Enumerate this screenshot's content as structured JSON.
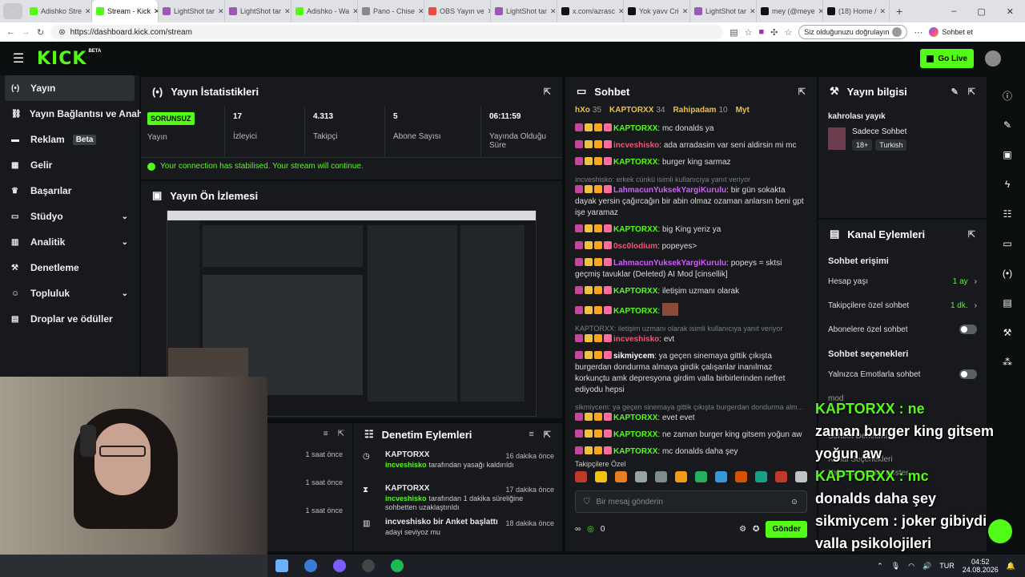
{
  "browser": {
    "tabs": [
      {
        "label": "Adishko Stre",
        "color": "#53fc18",
        "active": false
      },
      {
        "label": "Stream - Kick",
        "color": "#53fc18",
        "active": true
      },
      {
        "label": "LightShot tar",
        "color": "#9b59b6",
        "active": false
      },
      {
        "label": "LightShot tar",
        "color": "#9b59b6",
        "active": false
      },
      {
        "label": "Adishko - Wa",
        "color": "#53fc18",
        "active": false
      },
      {
        "label": "Pano - Chise",
        "color": "#888888",
        "active": false
      },
      {
        "label": "OBS Yayın ve",
        "color": "#e74c3c",
        "active": false
      },
      {
        "label": "LightShot tar",
        "color": "#9b59b6",
        "active": false
      },
      {
        "label": "x.com/azrasc",
        "color": "#111111",
        "active": false
      },
      {
        "label": "Yok yavv Cri",
        "color": "#111111",
        "active": false
      },
      {
        "label": "LightShot tar",
        "color": "#9b59b6",
        "active": false
      },
      {
        "label": "mey (@meye",
        "color": "#111111",
        "active": false
      },
      {
        "label": "(18) Home /",
        "color": "#111111",
        "active": false
      }
    ],
    "url": "https://dashboard.kick.com/stream",
    "verify_label": "Siz olduğunuzu doğrulayın",
    "profile_label": "Sohbet et"
  },
  "header": {
    "logo": "KICK",
    "beta": "BETA",
    "go_live": "Go Live"
  },
  "sidebar": {
    "items": [
      {
        "label": "Yayın",
        "icon": "broadcast-icon",
        "chev": false
      },
      {
        "label": "Yayın Bağlantısı ve Anahtarı",
        "icon": "link-icon",
        "chev": false
      },
      {
        "label": "Reklam",
        "icon": "ad-icon",
        "chev": false,
        "badge": "Beta"
      },
      {
        "label": "Gelir",
        "icon": "money-icon",
        "chev": false
      },
      {
        "label": "Başarılar",
        "icon": "trophy-icon",
        "chev": false
      },
      {
        "label": "Stüdyo",
        "icon": "studio-icon",
        "chev": true
      },
      {
        "label": "Analitik",
        "icon": "chart-icon",
        "chev": true
      },
      {
        "label": "Denetleme",
        "icon": "hammer-icon",
        "chev": false
      },
      {
        "label": "Topluluk",
        "icon": "people-icon",
        "chev": true
      },
      {
        "label": "Droplar ve ödüller",
        "icon": "gift-icon",
        "chev": false
      }
    ]
  },
  "stats": {
    "title": "Yayın İstatistikleri",
    "status": "SORUNSUZ",
    "status_label": "Yayın",
    "items": [
      {
        "value": "17",
        "label": "İzleyici"
      },
      {
        "value": "4.313",
        "label": "Takipçi"
      },
      {
        "value": "5",
        "label": "Abone Sayısı"
      },
      {
        "value": "06:11:59",
        "label": "Yayında Olduğu Süre"
      }
    ],
    "notice": "Your connection has stabilised. Your stream will continue."
  },
  "preview": {
    "title": "Yayın Ön İzlemesi"
  },
  "moderation": {
    "title": "Denetim Eylemleri",
    "left_times": [
      "1 saat önce",
      "1 saat önce",
      "1 saat önce"
    ],
    "items": [
      {
        "user": "KAPTORXX",
        "actor": "incveshisko",
        "text": "tarafından yasağı kaldırıldı",
        "time": "16 dakika önce"
      },
      {
        "user": "KAPTORXX",
        "actor": "incveshisko",
        "text": "tarafından 1 dakika süreliğine sohbetten uzaklaştırıldı",
        "time": "17 dakika önce"
      },
      {
        "user": "incveshisko bir Anket başlattı",
        "actor": "",
        "text": "adayi seviyoz mu",
        "time": "18 dakika önce"
      }
    ]
  },
  "chat": {
    "title": "Sohbet",
    "top_users": [
      {
        "name": "hXo",
        "count": "35"
      },
      {
        "name": "KAPTORXX",
        "count": "34"
      },
      {
        "name": "Rahipadam",
        "count": "10"
      },
      {
        "name": "Myt",
        "count": ""
      }
    ],
    "messages": [
      {
        "reply": "",
        "user": "KAPTORXX",
        "color": "#53fc18",
        "text": "mc donalds ya"
      },
      {
        "reply": "",
        "user": "incveshisko",
        "color": "#ff4f6d",
        "text": "ada arradasim var seni aldirsin mi mc"
      },
      {
        "reply": "",
        "user": "KAPTORXX",
        "color": "#53fc18",
        "text": "burger king sarmaz"
      },
      {
        "reply": "incveshisko: erkek cünkü isimli kullanıcıya yanıt veriyor",
        "user": "LahmacunYuksekYargiKurulu",
        "color": "#d35bff",
        "text": "bir gün sokakta dayak yersin çağırcağın bir abin olmaz ozaman anlarsın beni gpt işe yaramaz"
      },
      {
        "reply": "",
        "user": "KAPTORXX",
        "color": "#53fc18",
        "text": "big King yeriz ya"
      },
      {
        "reply": "",
        "user": "0sc0lodium",
        "color": "#ff4f6d",
        "text": "popeyes>"
      },
      {
        "reply": "",
        "user": "LahmacunYuksekYargiKurulu",
        "color": "#d35bff",
        "text": "popeys = sktsi geçmiş tavuklar (Deleted) AI Mod [cinsellik]"
      },
      {
        "reply": "",
        "user": "KAPTORXX",
        "color": "#53fc18",
        "text": "iletişim uzmanı olarak"
      },
      {
        "reply": "",
        "user": "KAPTORXX",
        "color": "#53fc18",
        "text": ""
      },
      {
        "reply": "KAPTORXX: iletişim uzmanı olarak isimli kullanıcıya yanıt veriyor",
        "user": "incveshisko",
        "color": "#ff4f6d",
        "text": "evt"
      },
      {
        "reply": "",
        "user": "sikmiycem",
        "color": "#ffffff",
        "text": "ya geçen sinemaya gittik çıkışta burgerdan dondurma almaya girdik çalışanlar inanılmaz korkunçtu amk depresyona girdim valla birbirlerinden nefret ediyodu hepsi"
      },
      {
        "reply": "sikmiycem: ya geçen sinemaya gittik çıkışta burgerdan dondurma alm...",
        "user": "KAPTORXX",
        "color": "#53fc18",
        "text": "evet evet"
      },
      {
        "reply": "",
        "user": "KAPTORXX",
        "color": "#53fc18",
        "text": "ne zaman burger king gitsem yoğun aw"
      },
      {
        "reply": "",
        "user": "KAPTORXX",
        "color": "#53fc18",
        "text": "mc donalds daha şey"
      },
      {
        "reply": "",
        "user": "sikmiycem",
        "color": "#ffffff",
        "text": "joker gibiydi valla psikolojileri"
      }
    ],
    "emote_label": "Takipçilere Özel",
    "input_placeholder": "Bir mesaj gönderin",
    "count": "0",
    "send_label": "Gönder"
  },
  "stream_info": {
    "title": "Yayın bilgisi",
    "stream_title": "kahrolası yayık",
    "category": "Sadece Sohbet",
    "tags": [
      "18+",
      "Turkish"
    ]
  },
  "channel": {
    "title": "Kanal Eylemleri",
    "access_title": "Sohbet erişimi",
    "rows": [
      {
        "label": "Hesap yaşı",
        "value": "1 ay",
        "type": "value"
      },
      {
        "label": "Takipçilere özel sohbet",
        "value": "1 dk.",
        "type": "value"
      },
      {
        "label": "Abonelere özel sohbet",
        "value": "",
        "type": "toggle"
      }
    ],
    "options_title": "Sohbet seçenekleri",
    "option_rows": [
      {
        "label": "Yalnızca Emotlarla sohbet",
        "type": "toggle"
      }
    ],
    "partial": [
      "mod",
      "Sohbet Denetimi",
      "Kanal Seçenekleri",
      "Yalnızca sayılar göster"
    ]
  },
  "overlay": [
    "KAPTORXX : ne",
    "zaman burger king gitsem",
    "yoğun aw",
    "KAPTORXX : mc",
    "donalds daha şey",
    "sikmiycem : joker gibiydi",
    "valla psikolojileri"
  ],
  "taskbar": {
    "lang": "TUR",
    "time": "04:52",
    "date": "24.08.2026"
  }
}
